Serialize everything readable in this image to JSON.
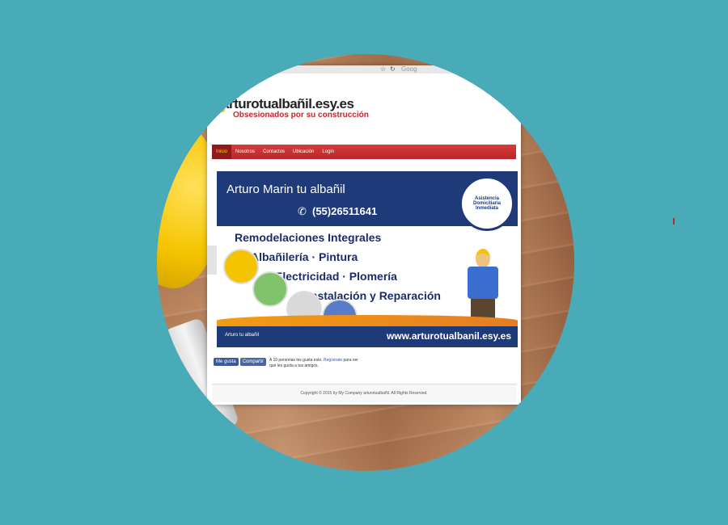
{
  "browser": {
    "toolbar_icons": [
      "☆",
      "↻"
    ],
    "search_hint": "Goog"
  },
  "site": {
    "logo_title": "arturotualbañil.esy.es",
    "logo_subtitle": "Obsesionados por su construcción"
  },
  "nav": {
    "items": [
      "Inicio",
      "Nosotros",
      "Contactos",
      "Ubicación",
      "Login"
    ],
    "active_index": 0
  },
  "banner": {
    "name": "Arturo Marin tu albañil",
    "phone": "(55)26511641",
    "seal_text": "Asistencia Domiciliaria Inmediata",
    "services": [
      "Remodelaciones Integrales",
      "Albañilería · Pintura",
      "Electricidad · Plomería",
      "Instalación y Reparación"
    ],
    "url": "www.arturotualbanil.esy.es",
    "facebook_label": "Arturo tu albañil"
  },
  "slider": {
    "next_glyph": "»"
  },
  "social": {
    "like_label": "Me gusta",
    "share_label": "Compartir",
    "text_before": "A 10 personas les gusta esto.",
    "link_text": "Regístrate",
    "text_after": "para ver qué les gusta a tus amigos."
  },
  "footer": {
    "copyright": "Copyright © 2015 by My Company arturotualbañil. All Rights Reserved."
  },
  "colors": {
    "background": "#4aabb8",
    "nav_red": "#c0282f",
    "banner_blue": "#1f3a78",
    "accent_orange": "#f39c12"
  }
}
